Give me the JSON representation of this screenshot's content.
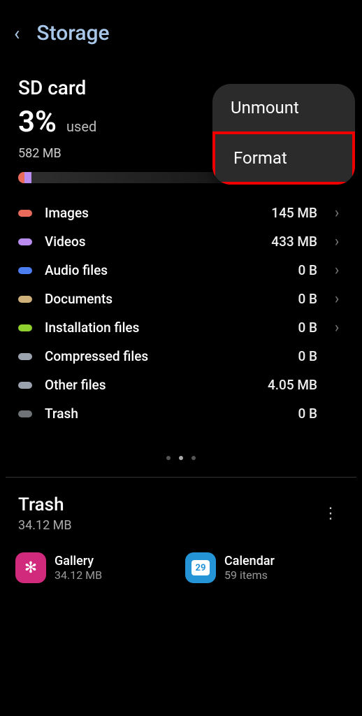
{
  "header": {
    "title": "Storage"
  },
  "card": {
    "title": "SD card",
    "percent": "3%",
    "used_label": "used",
    "total": "582 MB"
  },
  "categories": [
    {
      "name": "Images",
      "size": "145 MB",
      "color": "#e86a5a",
      "chev": true
    },
    {
      "name": "Videos",
      "size": "433 MB",
      "color": "#ba8cf0",
      "chev": true
    },
    {
      "name": "Audio files",
      "size": "0 B",
      "color": "#4b7ef0",
      "chev": true
    },
    {
      "name": "Documents",
      "size": "0 B",
      "color": "#d0b07a",
      "chev": true
    },
    {
      "name": "Installation files",
      "size": "0 B",
      "color": "#8fcf2e",
      "chev": true
    },
    {
      "name": "Compressed files",
      "size": "0 B",
      "color": "#9aa3ad",
      "chev": false
    },
    {
      "name": "Other files",
      "size": "4.05 MB",
      "color": "#9aa3ad",
      "chev": false
    },
    {
      "name": "Trash",
      "size": "0 B",
      "color": "#6f7378",
      "chev": false
    }
  ],
  "trash": {
    "title": "Trash",
    "size": "34.12 MB"
  },
  "apps": [
    {
      "name": "Gallery",
      "sub": "34.12 MB",
      "icon": "gallery",
      "badge": "✻"
    },
    {
      "name": "Calendar",
      "sub": "59 items",
      "icon": "calendar",
      "badge": "29"
    }
  ],
  "menu": {
    "items": [
      "Unmount",
      "Format"
    ]
  }
}
